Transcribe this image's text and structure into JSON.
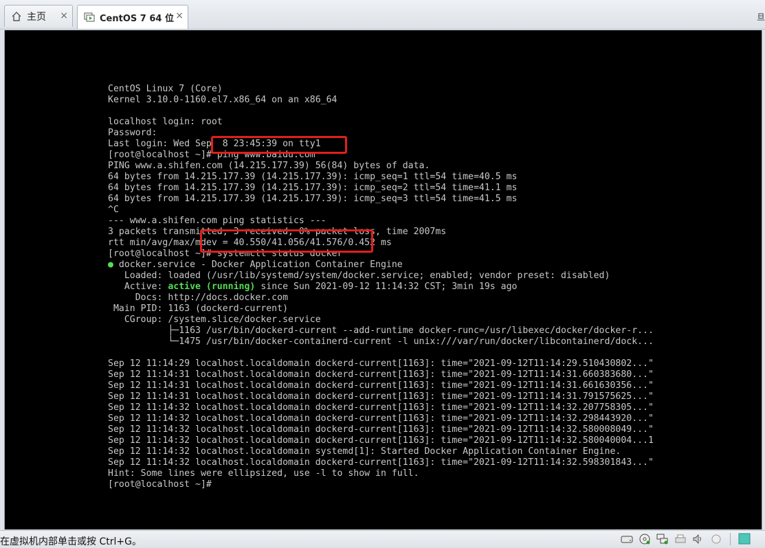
{
  "tabs": [
    {
      "label": "主页",
      "icon": "home-icon"
    },
    {
      "label": "CentOS 7 64 位",
      "icon": "vm-icon",
      "close": "×"
    }
  ],
  "home_close": "×",
  "right_edge_glyph": "旦",
  "console_lines": [
    "",
    "CentOS Linux 7 (Core)",
    "Kernel 3.10.0-1160.el7.x86_64 on an x86_64",
    "",
    "localhost login: root",
    "Password:",
    "Last login: Wed Sep  8 23:45:39 on tty1",
    "[root@localhost ~]# ping www.baidu.com",
    "PING www.a.shifen.com (14.215.177.39) 56(84) bytes of data.",
    "64 bytes from 14.215.177.39 (14.215.177.39): icmp_seq=1 ttl=54 time=40.5 ms",
    "64 bytes from 14.215.177.39 (14.215.177.39): icmp_seq=2 ttl=54 time=41.1 ms",
    "64 bytes from 14.215.177.39 (14.215.177.39): icmp_seq=3 ttl=54 time=41.5 ms",
    "^C",
    "--- www.a.shifen.com ping statistics ---",
    "3 packets transmitted, 3 received, 0% packet loss, time 2007ms",
    "rtt min/avg/max/mdev = 40.550/41.056/41.576/0.452 ms",
    "[root@localhost ~]# systemctl status docker"
  ],
  "docker_status": {
    "bullet": "●",
    "service_line": " docker.service - Docker Application Container Engine",
    "loaded_line": "   Loaded: loaded (/usr/lib/systemd/system/docker.service; enabled; vendor preset: disabled)",
    "active_prefix": "   Active: ",
    "active_state": "active (running)",
    "active_suffix": " since Sun 2021-09-12 11:14:32 CST; 3min 19s ago",
    "rest": [
      "     Docs: http://docs.docker.com",
      " Main PID: 1163 (dockerd-current)",
      "   CGroup: /system.slice/docker.service",
      "           ├─1163 /usr/bin/dockerd-current --add-runtime docker-runc=/usr/libexec/docker/docker-r...",
      "           └─1475 /usr/bin/docker-containerd-current -l unix:///var/run/docker/libcontainerd/dock...",
      "",
      "Sep 12 11:14:29 localhost.localdomain dockerd-current[1163]: time=\"2021-09-12T11:14:29.510430802...\"",
      "Sep 12 11:14:31 localhost.localdomain dockerd-current[1163]: time=\"2021-09-12T11:14:31.660383680...\"",
      "Sep 12 11:14:31 localhost.localdomain dockerd-current[1163]: time=\"2021-09-12T11:14:31.661630356...\"",
      "Sep 12 11:14:31 localhost.localdomain dockerd-current[1163]: time=\"2021-09-12T11:14:31.791575625...\"",
      "Sep 12 11:14:32 localhost.localdomain dockerd-current[1163]: time=\"2021-09-12T11:14:32.207758305...\"",
      "Sep 12 11:14:32 localhost.localdomain dockerd-current[1163]: time=\"2021-09-12T11:14:32.298443920...\"",
      "Sep 12 11:14:32 localhost.localdomain dockerd-current[1163]: time=\"2021-09-12T11:14:32.580008049...\"",
      "Sep 12 11:14:32 localhost.localdomain dockerd-current[1163]: time=\"2021-09-12T11:14:32.580040004...1",
      "Sep 12 11:14:32 localhost.localdomain systemd[1]: Started Docker Application Container Engine.",
      "Sep 12 11:14:32 localhost.localdomain dockerd-current[1163]: time=\"2021-09-12T11:14:32.598301843...\"",
      "Hint: Some lines were ellipsized, use -l to show in full.",
      "[root@localhost ~]#"
    ]
  },
  "statusbar": {
    "hint": "在虚拟机内部单击或按 Ctrl+G。",
    "tray_icons": [
      "hard-disk-icon",
      "cd-dvd-icon",
      "network-icon",
      "printer-icon",
      "sound-icon",
      "usb-icon",
      "message-icon"
    ]
  },
  "colors": {
    "highlight_box": "#e0201c",
    "active_green": "#55dd55",
    "terminal_bg": "#000000"
  }
}
